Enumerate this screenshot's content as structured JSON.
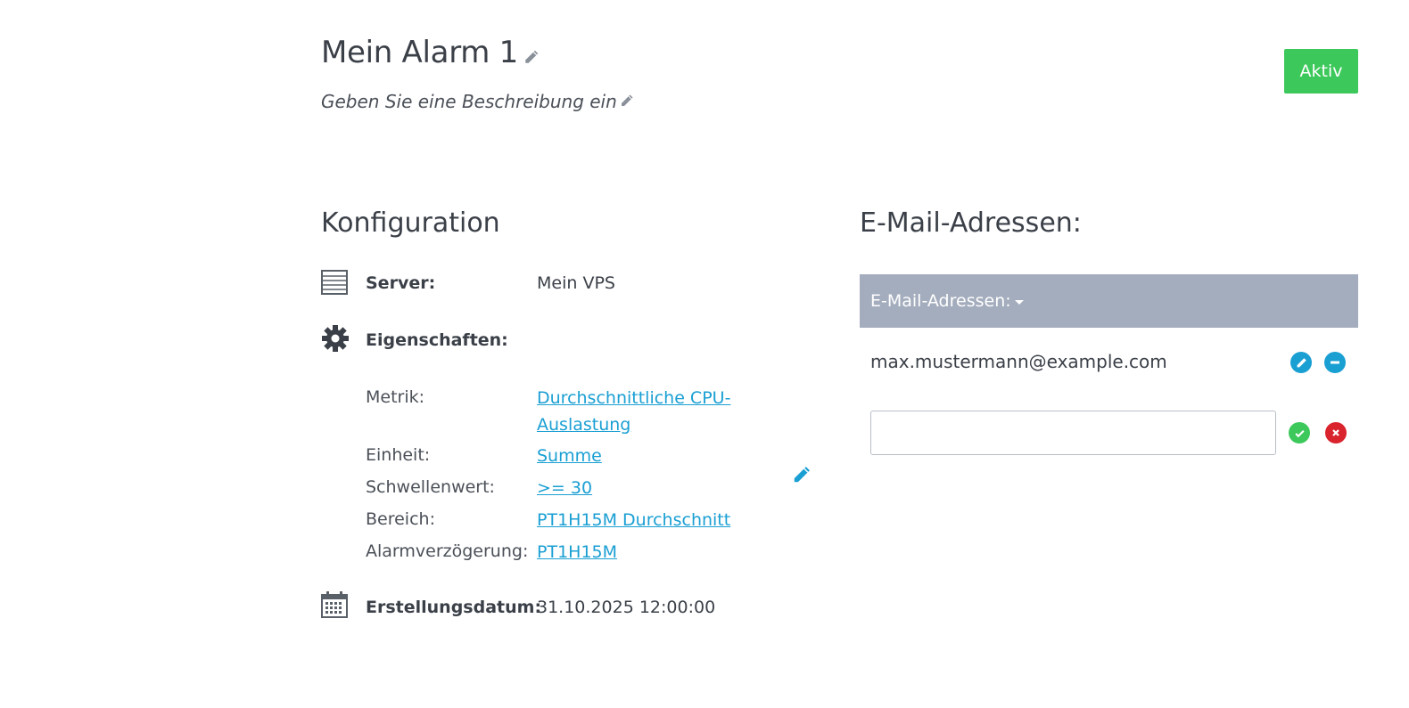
{
  "alarm": {
    "title": "Mein Alarm 1",
    "description_placeholder": "Geben Sie eine Beschreibung ein",
    "status_label": "Aktiv",
    "status_color": "#3cc85a"
  },
  "config": {
    "title": "Konfiguration",
    "server_label": "Server:",
    "server_value": "Mein VPS",
    "properties_label": "Eigenschaften:",
    "metric_label": "Metrik:",
    "metric_value": "Durchschnittliche CPU-Auslastung",
    "unit_label": "Einheit:",
    "unit_value": "Summe",
    "threshold_label": "Schwellenwert:",
    "threshold_value": ">= 30",
    "range_label": "Bereich:",
    "range_value": "PT1H15M Durchschnitt",
    "delay_label": "Alarmverzögerung:",
    "delay_value": "PT1H15M",
    "created_label": "Erstellungsdatum:",
    "created_value": "31.10.2025 12:00:00"
  },
  "email": {
    "title": "E-Mail-Adressen:",
    "header_label": "E-Mail-Adressen:",
    "items": [
      {
        "address": "max.mustermann@example.com"
      }
    ],
    "new_input_value": ""
  },
  "icons": {
    "title_edit": "pencil-icon",
    "server": "server-icon",
    "properties": "gear-icon",
    "created": "calendar-icon",
    "accent": "#1a9fd3",
    "confirm": "#3cc85a",
    "cancel": "#d9232d"
  }
}
